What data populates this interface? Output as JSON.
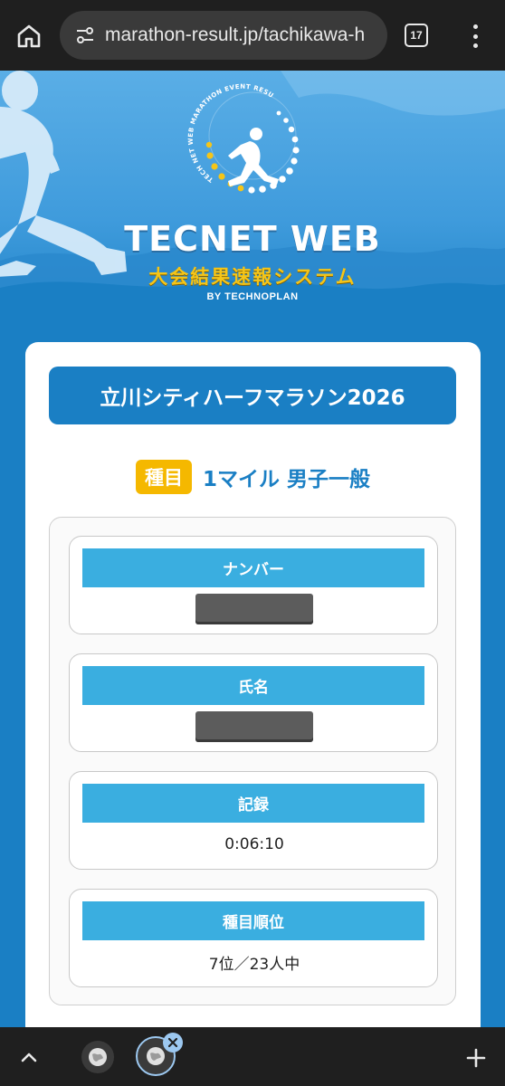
{
  "browser": {
    "url": "marathon-result.jp/tachikawa-h",
    "tab_count": "17"
  },
  "hero": {
    "ring_text": "TECH NET WEB MARATHON EVENT RESULTS",
    "brand_title": "TECNET WEB",
    "brand_subtitle": "大会結果速報システム",
    "brand_by": "BY TECHNOPLAN"
  },
  "event": {
    "title": "立川シティハーフマラソン2026",
    "category_badge": "種目",
    "category_name": "1マイル 男子一般"
  },
  "results": [
    {
      "label": "ナンバー",
      "value": "",
      "redacted": true
    },
    {
      "label": "氏名",
      "value": "",
      "redacted": true
    },
    {
      "label": "記録",
      "value": "0:06:10",
      "redacted": false
    },
    {
      "label": "種目順位",
      "value": "7位／23人中",
      "redacted": false
    }
  ],
  "colors": {
    "brand_blue": "#1a7fc4",
    "label_blue": "#3aaee0",
    "badge_yellow": "#f5b800"
  }
}
